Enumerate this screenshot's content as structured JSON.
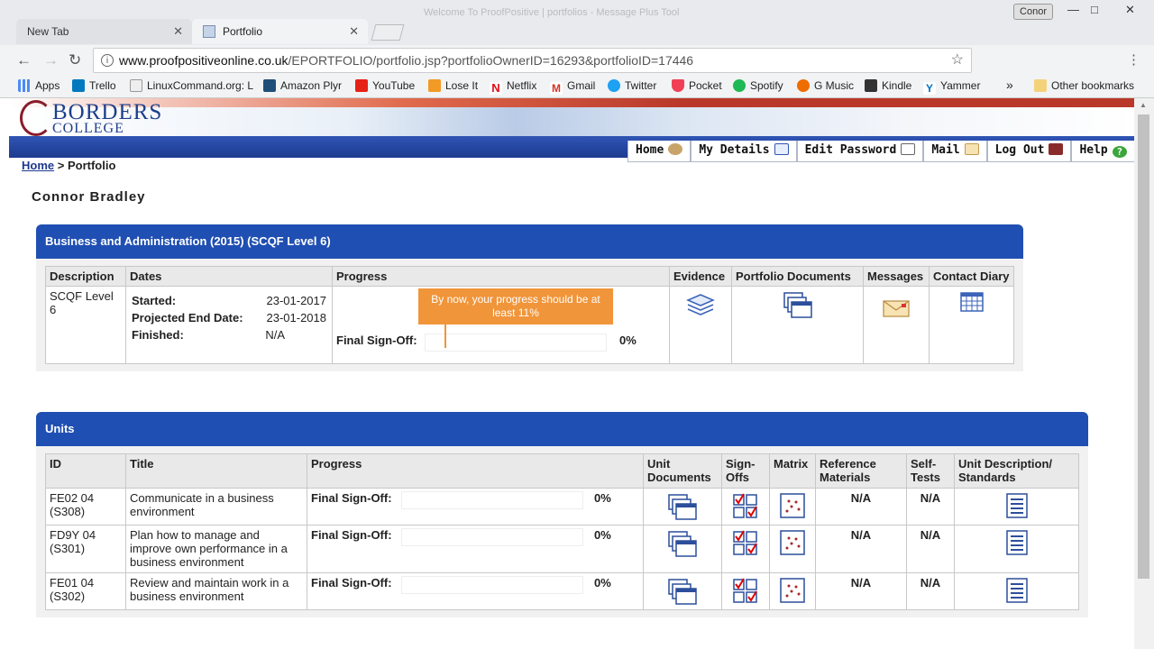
{
  "browser": {
    "tabs": [
      {
        "label": "New Tab"
      },
      {
        "label": "Portfolio"
      }
    ],
    "window_title": "Welcome To ProofPositive | portfolios - Message Plus Tool",
    "user": "Conor",
    "url_domain": "www.proofpositiveonline.co.uk",
    "url_path": "/EPORTFOLIO/portfolio.jsp?portfolioOwnerID=16293&portfolioID=17446",
    "bookmarks": [
      "Apps",
      "Trello",
      "LinuxCommand.org: L",
      "Amazon Plyr",
      "YouTube",
      "Lose It",
      "Netflix",
      "Gmail",
      "Twitter",
      "Pocket",
      "Spotify",
      "G Music",
      "Kindle",
      "Yammer"
    ],
    "bookmarks_more": "»",
    "other_bookmarks": "Other bookmarks"
  },
  "site": {
    "logo_line1": "BORDERS",
    "logo_line2": "COLLEGE",
    "nav": [
      "Home",
      "My Details",
      "Edit Password",
      "Mail",
      "Log Out",
      "Help"
    ],
    "breadcrumb_home": "Home",
    "breadcrumb_sep": " > ",
    "breadcrumb_current": "Portfolio"
  },
  "owner_name": "Connor Bradley",
  "portfolio": {
    "title": "Business and Administration (2015) (SCQF Level 6)",
    "headers": [
      "Description",
      "Dates",
      "Progress",
      "Evidence",
      "Portfolio Documents",
      "Messages",
      "Contact Diary"
    ],
    "description": "SCQF Level 6",
    "started_label": "Started:",
    "started": "23-01-2017",
    "projected_label": "Projected End Date:",
    "projected": "23-01-2018",
    "finished_label": "Finished:",
    "finished": "N/A",
    "final_signoff_label": "Final Sign-Off:",
    "progress_pct": "0%",
    "tooltip": "By now, your progress should be at least 11%"
  },
  "units": {
    "title": "Units",
    "headers": [
      "ID",
      "Title",
      "Progress",
      "Unit Documents",
      "Sign-Offs",
      "Matrix",
      "Reference Materials",
      "Self-Tests",
      "Unit Description/ Standards"
    ],
    "rows": [
      {
        "id": "FE02 04 (S308)",
        "title": "Communicate in a business environment",
        "progress_label": "Final Sign-Off:",
        "pct": "0%",
        "ref": "N/A",
        "self": "N/A"
      },
      {
        "id": "FD9Y 04 (S301)",
        "title": "Plan how to manage and improve own performance in a business environment",
        "progress_label": "Final Sign-Off:",
        "pct": "0%",
        "ref": "N/A",
        "self": "N/A"
      },
      {
        "id": "FE01 04 (S302)",
        "title": "Review and maintain work in a business environment",
        "progress_label": "Final Sign-Off:",
        "pct": "0%",
        "ref": "N/A",
        "self": "N/A"
      }
    ]
  },
  "colors": {
    "header_blue": "#1f4fb2",
    "tooltip_orange": "#f0953a",
    "brand_red": "#b9382a"
  }
}
